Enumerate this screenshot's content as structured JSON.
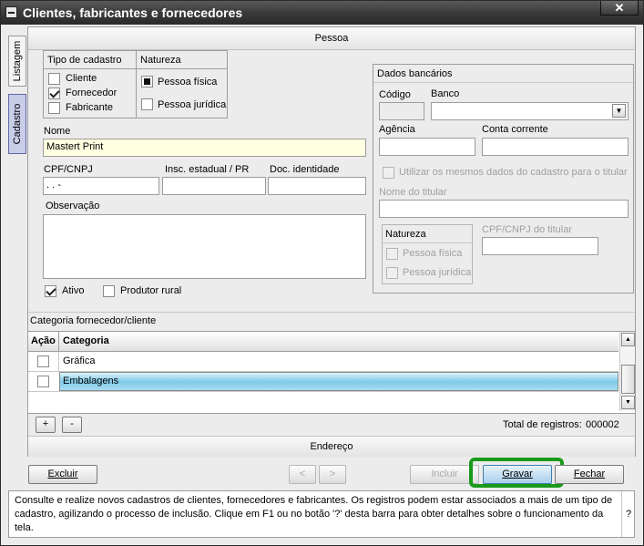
{
  "window": {
    "title": "Clientes, fabricantes e fornecedores",
    "close_glyph": "✕"
  },
  "sidetabs": {
    "listagem": "Listagem",
    "cadastro": "Cadastro"
  },
  "pessoa": {
    "section_title": "Pessoa",
    "tipo_label": "Tipo de cadastro",
    "tipo_options": [
      {
        "label": "Cliente",
        "checked": false
      },
      {
        "label": "Fornecedor",
        "checked": true
      },
      {
        "label": "Fabricante",
        "checked": false
      }
    ],
    "natureza_label": "Natureza",
    "natureza_options": [
      {
        "label": "Pessoa física",
        "selected": true
      },
      {
        "label": "Pessoa jurídica",
        "selected": false
      }
    ],
    "nome_label": "Nome",
    "nome_value": "Mastert Print",
    "cpf_label": "CPF/CNPJ",
    "cpf_value": ".   .   -",
    "insc_label": "Insc. estadual / PR",
    "insc_value": "",
    "doc_label": "Doc. identidade",
    "doc_value": "",
    "obs_label": "Observação",
    "obs_value": "",
    "ativo_label": "Ativo",
    "ativo_checked": true,
    "produtor_label": "Produtor rural",
    "produtor_checked": false
  },
  "bancarios": {
    "title": "Dados bancários",
    "codigo_label": "Código",
    "banco_label": "Banco",
    "agencia_label": "Agência",
    "conta_label": "Conta corrente",
    "mesmos_label": "Utilizar os mesmos dados do cadastro para o titular",
    "nome_titular_label": "Nome do titular",
    "natureza_label": "Natureza",
    "natureza_options": [
      "Pessoa física",
      "Pessoa jurídica"
    ],
    "cpf_titular_label": "CPF/CNPJ do titular"
  },
  "categoria": {
    "title": "Categoria fornecedor/cliente",
    "col_acao": "Ação",
    "col_categoria": "Categoria",
    "rows": [
      {
        "name": "Gráfica",
        "selected": false
      },
      {
        "name": "Embalagens",
        "selected": true
      }
    ],
    "add_label": "+",
    "remove_label": "-",
    "total_label": "Total de registros:",
    "total_value": "000002"
  },
  "endereco": {
    "section_title": "Endereço"
  },
  "footer": {
    "excluir": "Excluir",
    "prev": "<",
    "next": ">",
    "incluir": "Incluir",
    "gravar": "Gravar",
    "fechar": "Fechar",
    "highlight_color": "#1a9a1a"
  },
  "info": {
    "text": "Consulte e realize novos cadastros de clientes, fornecedores e fabricantes. Os registros podem estar associados a mais de um tipo de cadastro, agilizando o processo de inclusão. Clique em F1 ou no botão '?' desta barra para obter detalhes sobre o funcionamento da tela.",
    "help": "?"
  }
}
